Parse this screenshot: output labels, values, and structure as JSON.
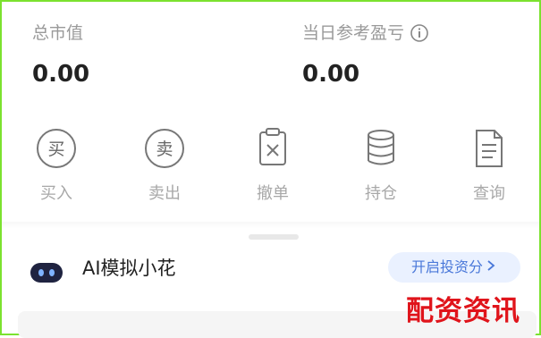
{
  "summary": {
    "total_market_value": {
      "label": "总市值",
      "value": "0.00"
    },
    "daily_pnl": {
      "label": "当日参考盈亏",
      "value": "0.00",
      "info_icon": "info-icon"
    }
  },
  "actions": [
    {
      "label": "买入",
      "icon": "buy-circle-icon",
      "glyph": "买"
    },
    {
      "label": "卖出",
      "icon": "sell-circle-icon",
      "glyph": "卖"
    },
    {
      "label": "撤单",
      "icon": "cancel-order-icon"
    },
    {
      "label": "持仓",
      "icon": "holdings-stack-icon"
    },
    {
      "label": "查询",
      "icon": "query-document-icon"
    }
  ],
  "ai": {
    "title": "AI模拟小花",
    "button_label": "开启投资分",
    "avatar_icon": "robot-avatar-icon"
  },
  "watermark": "配资资讯",
  "colors": {
    "frame": "#7be22f",
    "label_gray": "#9a9a9a",
    "value_dark": "#222222",
    "accent_blue": "#4a78d9",
    "watermark_red": "#e0141b"
  }
}
